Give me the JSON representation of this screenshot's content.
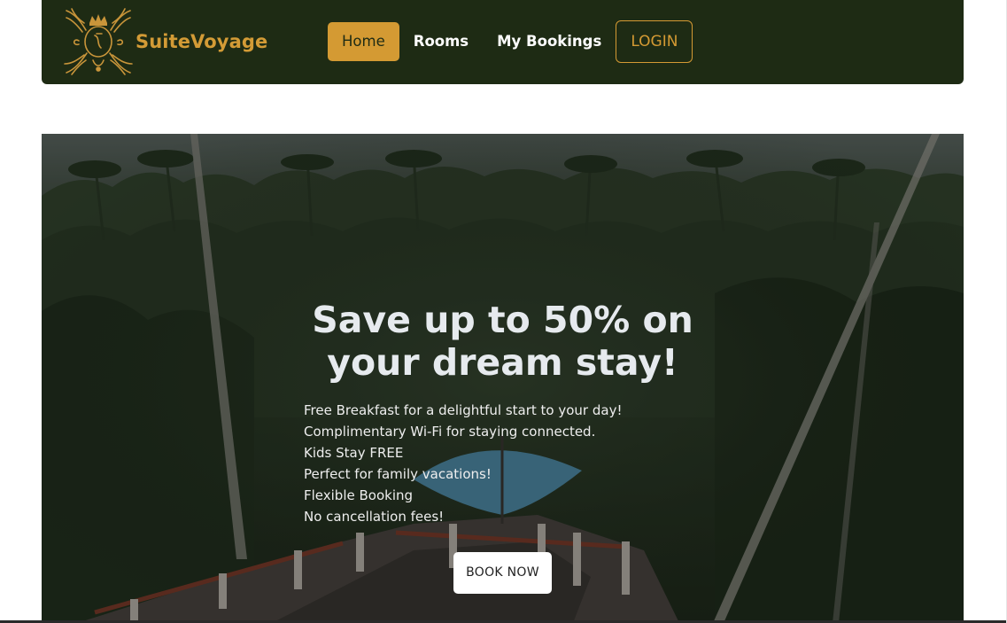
{
  "brand": {
    "name": "SuiteVoyage",
    "logo_icon": "ornate-crest-icon",
    "accent_color": "#d39b36",
    "navbar_color": "#1e2b14"
  },
  "nav": {
    "items": [
      {
        "label": "Home",
        "active": true
      },
      {
        "label": "Rooms",
        "active": false
      },
      {
        "label": "My Bookings",
        "active": false
      }
    ],
    "login_label": "LOGIN"
  },
  "hero": {
    "title_line1": "Save up to 50% on",
    "title_line2": "your dream stay!",
    "perks": [
      "Free Breakfast for a delightful start to your day!",
      "Complimentary Wi-Fi for staying connected.",
      "Kids Stay FREE",
      "Perfect for family vacations!",
      "Flexible Booking",
      "No cancellation fees!"
    ],
    "cta_label": "BOOK NOW",
    "background": "tropical-jungle-resort-image"
  }
}
